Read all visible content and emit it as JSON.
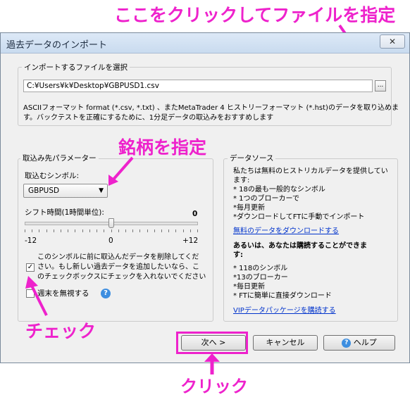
{
  "annotations": {
    "top_text": "ここをクリックしてファイルを指定",
    "symbol_text": "銘柄を指定",
    "check_text": "チェック",
    "click_text": "クリック"
  },
  "window": {
    "title": "過去データのインポート",
    "close_glyph": "✕"
  },
  "file_section": {
    "label": "インポートするファイルを選択",
    "path": "C:¥Users¥k¥Desktop¥GBPUSD1.csv",
    "browse_label": "...",
    "description_line1": "ASCIIフォーマット format (*.csv, *.txt) 、またMetaTrader 4 ヒストリーフォーマット (*.hst)のデータを取り込めま",
    "description_line2": "す。バックテストを正確にするために、1分足データの取込みをおすすめします"
  },
  "params": {
    "label": "取込み先パラメーター",
    "symbol_label": "取込むシンボル:",
    "symbol_value": "GBPUSD",
    "shift_label": "シフト時間(1時間単位):",
    "shift_value": "0",
    "shift_min": "-12",
    "shift_mid": "0",
    "shift_max": "+12",
    "slider_fraction": 0.5,
    "delete_checkbox_line1": "このシンボルに前に取込んだデータを削除してくだ",
    "delete_checkbox_line2": "さい。もし新しい過去データを追加したいなら、こ",
    "delete_checkbox_line3": "のチェックボックスにチェックを入れないでください",
    "delete_checked": true,
    "weekend_label": "週末を無視する",
    "weekend_checked": false,
    "help_glyph": "?"
  },
  "datasource": {
    "label": "データソース",
    "free_intro_line1": "私たちは無料のヒストリカルデータを提供してい",
    "free_intro_line2": "ます:",
    "free_items": [
      "* 18の最も一般的なシンボル",
      "* 1つのブローカーで",
      "*毎月更新",
      "*ダウンロードしてFTに手動でインポート"
    ],
    "free_link": "無料のデータをダウンロードする",
    "paid_intro_line1": "あるいは、あなたは購読することができま",
    "paid_intro_line2": "す:",
    "paid_items": [
      "* 118のシンボル",
      "*13のブローカー",
      "*毎日更新",
      "* FTに簡単に直接ダウンロード"
    ],
    "paid_link": "VIPデータパッケージを購読する"
  },
  "buttons": {
    "next": "次へ >",
    "cancel": "キャンセル",
    "help": "ヘルプ",
    "help_glyph": "?"
  },
  "colors": {
    "annotation": "#ee22cc",
    "link": "#0033cc"
  }
}
